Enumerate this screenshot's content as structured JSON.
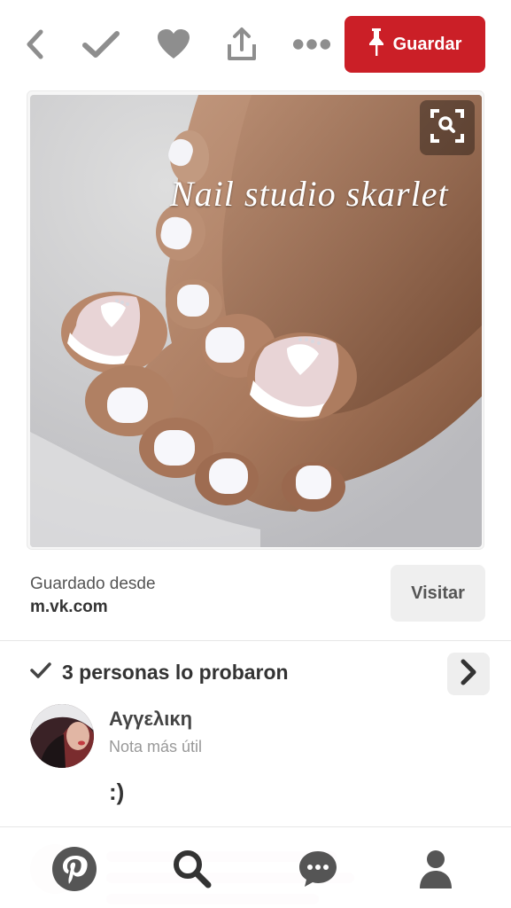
{
  "toolbar": {
    "save_label": "Guardar",
    "icons": [
      "back-icon",
      "check-icon",
      "heart-icon",
      "share-icon",
      "more-icon"
    ]
  },
  "pin": {
    "watermark": "Nail studio  skarlet"
  },
  "source": {
    "label": "Guardado desde",
    "domain": "m.vk.com",
    "visit_label": "Visitar"
  },
  "tried": {
    "text": "3 personas lo probaron"
  },
  "comment": {
    "user": "Αγγελικη",
    "tag": "Nota más útil",
    "text": ":)"
  },
  "colors": {
    "brand": "#cb1f27",
    "icon_gray": "#8e8e8e",
    "nav_dark": "#555555"
  }
}
